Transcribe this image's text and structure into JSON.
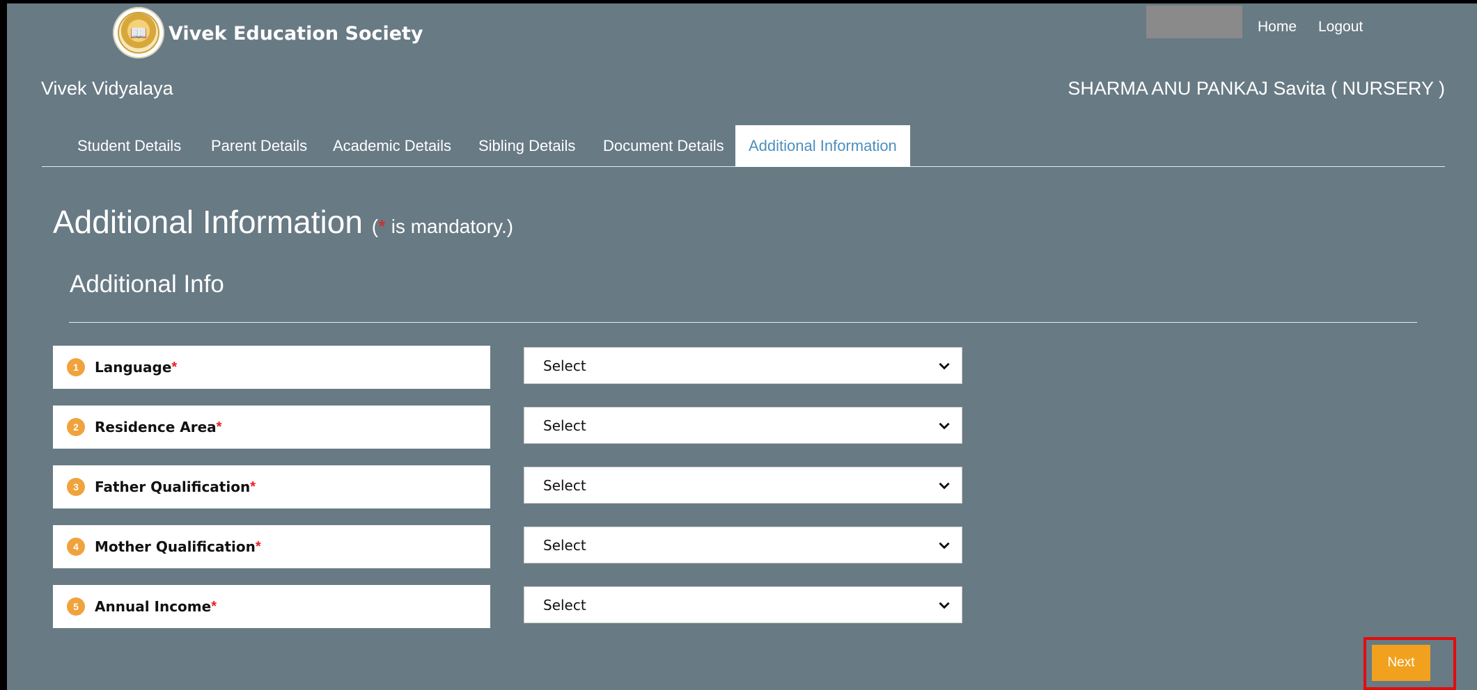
{
  "header": {
    "brand": "Vivek Education Society",
    "home": "Home",
    "logout": "Logout",
    "school": "Vivek Vidyalaya",
    "student": "SHARMA ANU PANKAJ Savita ( NURSERY )"
  },
  "tabs": [
    {
      "label": "Student Details"
    },
    {
      "label": "Parent Details"
    },
    {
      "label": "Academic Details"
    },
    {
      "label": "Sibling Details"
    },
    {
      "label": "Document Details"
    },
    {
      "label": "Additional Information",
      "active": true
    }
  ],
  "page": {
    "title": "Additional Information",
    "note_open": "(",
    "note_star": "*",
    "note_rest": " is mandatory.)",
    "section": "Additional Info"
  },
  "fields": [
    {
      "num": "1",
      "label": "Language",
      "required": "*",
      "value": "Select"
    },
    {
      "num": "2",
      "label": "Residence Area",
      "required": "*",
      "value": "Select"
    },
    {
      "num": "3",
      "label": "Father Qualification",
      "required": "*",
      "value": "Select"
    },
    {
      "num": "4",
      "label": "Mother Qualification",
      "required": "*",
      "value": "Select"
    },
    {
      "num": "5",
      "label": "Annual Income",
      "required": "*",
      "value": "Select"
    }
  ],
  "next_label": "Next",
  "colors": {
    "background": "#687a84",
    "active_tab_text": "#4d8fbd",
    "badge": "#f0a23c",
    "next_button": "#f1a11e",
    "required": "#e81e1e",
    "highlight": "#e30b0b"
  },
  "icons": {
    "logo": "school-emblem-icon",
    "select_arrow": "chevron-down-icon"
  }
}
